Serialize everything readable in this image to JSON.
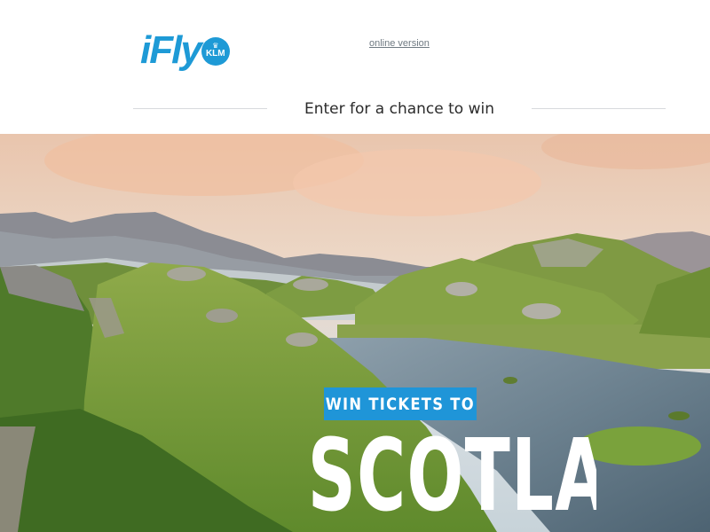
{
  "header": {
    "logo_text": "iFly",
    "logo_badge": "KLM",
    "online_version_link": "online version",
    "tagline": "Enter for a chance to win"
  },
  "hero": {
    "image": "scottish-highlands-landscape",
    "badge_text": "WIN TICKETS TO",
    "destination": "SCOTLAND"
  },
  "colors": {
    "brand_blue": "#1e9ad6",
    "badge_blue": "#1f95d8",
    "link_gray": "#6f7a82",
    "text_dark": "#2b2b2b"
  }
}
